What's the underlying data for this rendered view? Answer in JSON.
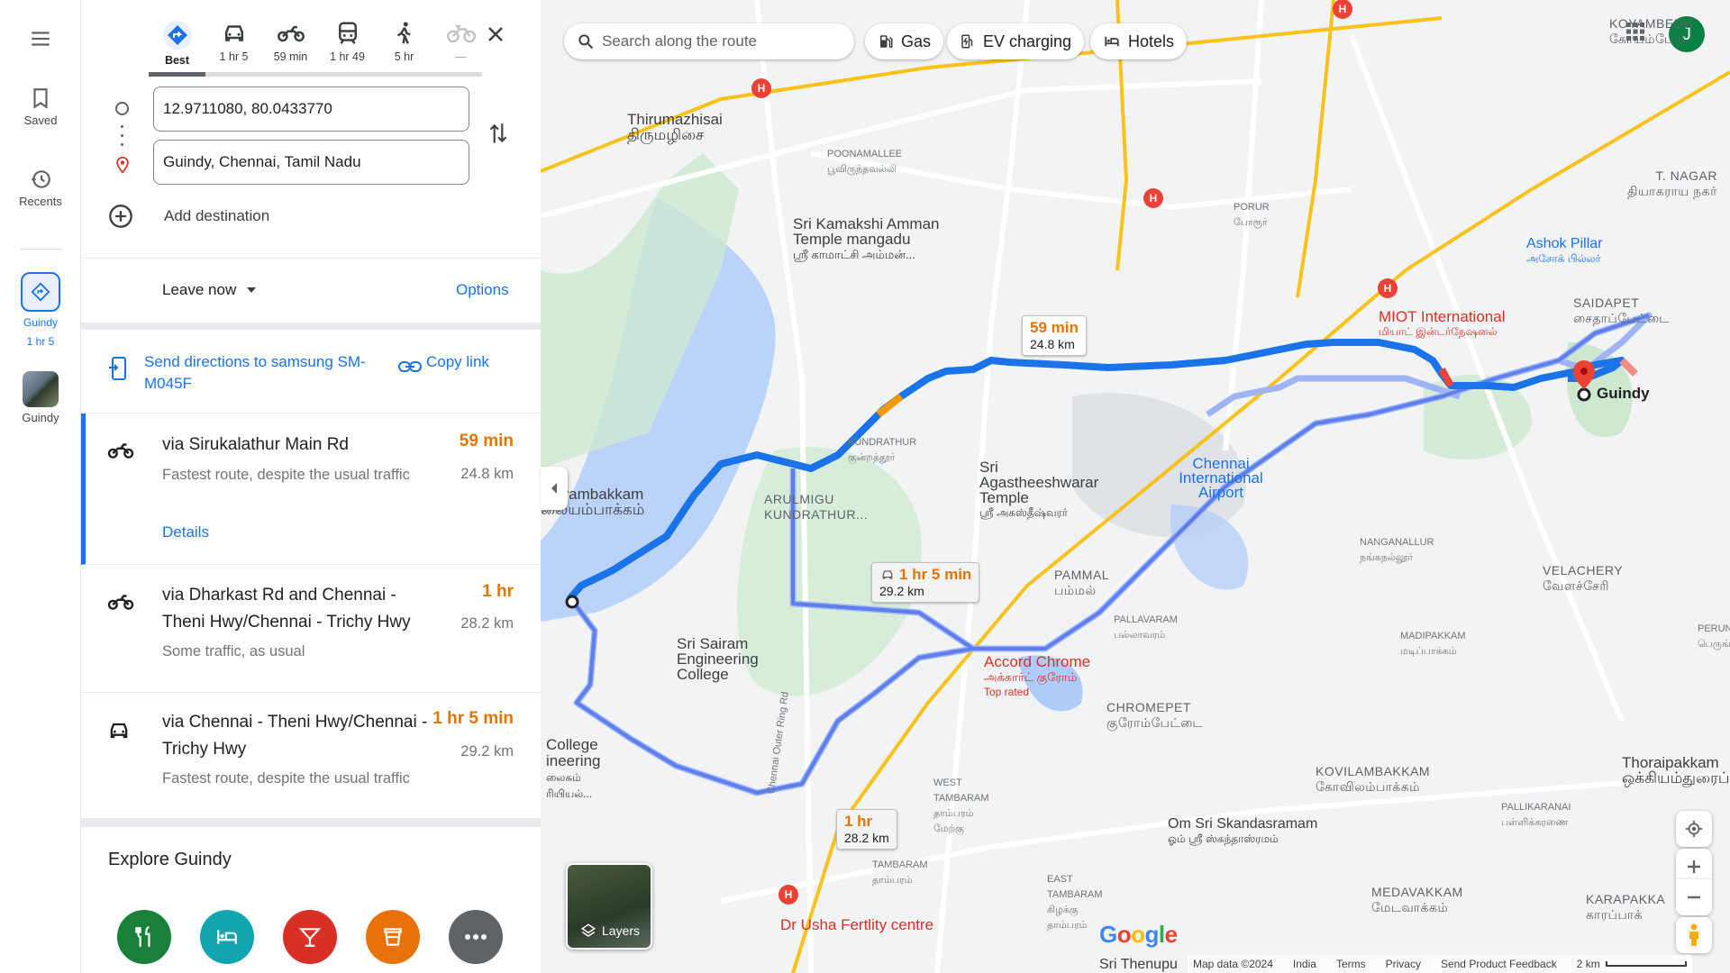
{
  "rail": {
    "saved_label": "Saved",
    "recents_label": "Recents",
    "trip_label": "Guindy",
    "trip_time": "1 hr 5",
    "place_label": "Guindy"
  },
  "modes": [
    {
      "label": "Best",
      "icon": "best-route-icon"
    },
    {
      "label": "1 hr 5",
      "icon": "car-icon"
    },
    {
      "label": "59 min",
      "icon": "motorcycle-icon"
    },
    {
      "label": "1 hr 49",
      "icon": "transit-icon"
    },
    {
      "label": "5 hr",
      "icon": "walk-icon"
    },
    {
      "label": "—",
      "icon": "bicycle-icon"
    }
  ],
  "directions": {
    "origin": "12.9711080, 80.0433770",
    "destination": "Guindy, Chennai, Tamil Nadu",
    "add_destination": "Add destination",
    "leave_now": "Leave now",
    "options": "Options",
    "send_directions": "Send directions to samsung SM-M045F",
    "copy_link": "Copy link"
  },
  "routes": [
    {
      "name": "via Sirukalathur Main Rd",
      "subtitle": "Fastest route, despite the usual traffic",
      "time": "59 min",
      "distance": "24.8 km",
      "details": "Details",
      "vehicle": "motorcycle-icon"
    },
    {
      "name": "via Dharkast Rd and Chennai - Theni Hwy/Chennai - Trichy Hwy",
      "subtitle": "Some traffic, as usual",
      "time": "1 hr",
      "distance": "28.2 km",
      "vehicle": "motorcycle-icon"
    },
    {
      "name": "via Chennai - Theni Hwy/Chennai - Trichy Hwy",
      "subtitle": "Fastest route, despite the usual traffic",
      "time": "1 hr 5 min",
      "distance": "29.2 km",
      "vehicle": "car-icon"
    }
  ],
  "explore": {
    "title": "Explore Guindy",
    "categories": [
      {
        "icon": "restaurant-icon",
        "color": "#188038"
      },
      {
        "icon": "hotel-icon",
        "color": "#12a4af"
      },
      {
        "icon": "bar-icon",
        "color": "#d93025"
      },
      {
        "icon": "coffee-icon",
        "color": "#e8710a"
      },
      {
        "icon": "more-icon",
        "color": "#5f6368"
      }
    ]
  },
  "map": {
    "search_placeholder": "Search along the route",
    "chips": [
      "Gas",
      "EV charging",
      "Hotels"
    ],
    "avatar_letter": "J",
    "callouts": [
      {
        "time": "59 min",
        "dist": "24.8 km"
      },
      {
        "time": "1 hr 5 min",
        "dist": "29.2 km"
      },
      {
        "time": "1 hr",
        "dist": "28.2 km"
      }
    ],
    "labels": {
      "koyambedu": "KOYAMBEDU",
      "koyambedu_ta": "கோயம்பேடு",
      "thirumazhisai": "Thirumazhisai",
      "thirumazhisai_ta": "திருமழிசை",
      "poonamallee": "POONAMALLEE",
      "poonamallee_ta": "பூவிருந்தவல்லி",
      "sri_kamakshi": "Sri Kamakshi Amman Temple mangadu",
      "sri_kamakshi_ta": "ஸ்ரீ காமாட்சி அம்மன்...",
      "porur": "PORUR",
      "porur_ta": "போரூர்",
      "t_nagar": "T. NAGAR",
      "t_nagar_ta": "தியாகராய நகர்",
      "ashok_pillar": "Ashok Pillar",
      "ashok_pillar_ta": "அசோக் பில்லர்",
      "saidapet": "SAIDAPET",
      "saidapet_ta": "சைதாப்பேட்டை",
      "miot": "MIOT International",
      "miot_ta": "மியாட் இன்டர்நேஷனல்",
      "guindy": "Guindy",
      "kundrathur": "KUNDRATHUR",
      "kundrathur_ta": "குன்றத்தூர்",
      "sri_agastheeshwarar": "Sri Agastheeshwarar Temple",
      "sri_agastheeshwarar_ta": "ஸ்ரீ அகஸ்தீஷ்வரர்",
      "chennai_airport": "Chennai International Airport",
      "malayambakkam": "alayambakkam",
      "malayambakkam_ta": "லையம்பாக்கம்",
      "arulmigu": "ARULMIGU KUNDRATHUR...",
      "pammal": "PAMMAL",
      "pammal_ta": "பம்மல்",
      "nanganallur": "NANGANALLUR",
      "nanganallur_ta": "நங்கநல்லூர்",
      "velachery": "VELACHERY",
      "velachery_ta": "வேளச்சேரி",
      "pallavaram": "PALLAVARAM",
      "pallavaram_ta": "பல்லாவரம்",
      "sri_sairam": "Sri Sairam Engineering College",
      "accord": "Accord Chrome",
      "accord_ta": "அக்கார்ட் குரோம்",
      "accord_sub": "Top rated",
      "chromepet": "CHROMEPET",
      "chromepet_ta": "குரோம்பேட்டை",
      "madipakkam": "MADIPAKKAM",
      "madipakkam_ta": "மடிப்பாக்கம்",
      "perun": "PERUN",
      "perun_ta": "பெருங்",
      "college": "College",
      "college2": "ineering",
      "college_ta1": "லைசும்",
      "college_ta2": "ரியியல்...",
      "kovilambakkam": "KOVILAMBAKKAM",
      "kovilambakkam_ta": "கோவிலம்பாக்கம்",
      "thoraipakkam": "Thoraipakkam",
      "thoraipakkam_ta": "ஒக்கியம்துரைப்பா",
      "pallikaranai": "PALLIKARANAI",
      "pallikaranai_ta": "பள்ளிக்கரணை",
      "west_tambaram": "WEST TAMBARAM",
      "west_tambaram_ta": "தாம்பரம் மேற்கு",
      "om_sri": "Om Sri Skandasramam",
      "om_sri_ta": "ஓம் ஸ்ரீ ஸ்கந்தாஸ்ரமம்",
      "tambaram": "TAMBARAM",
      "tambaram_ta": "தாம்பரம்",
      "east_tambaram": "EAST TAMBARAM",
      "east_tambaram_ta": "கிழக்கு தாம்பரம்",
      "medavakkam": "MEDAVAKKAM",
      "medavakkam_ta": "மேடவாக்கம்",
      "karapakka": "KARAPAKKA",
      "karapakka_ta": "காரப்பாக்",
      "dr_usha": "Dr Usha Fertlity centre",
      "sri_thenupu": "Sri Thenupu",
      "outer_ring": "Chennai Outer Ring Rd"
    },
    "layers": "Layers",
    "footer": [
      "Map data ©2024",
      "India",
      "Terms",
      "Privacy",
      "Send Product Feedback",
      "2 km"
    ]
  }
}
